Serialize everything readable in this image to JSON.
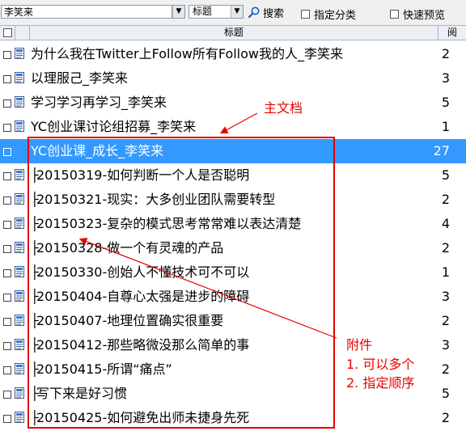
{
  "toolbar": {
    "search_value": "李笑来",
    "field_selected": "标题",
    "search_label": "搜索",
    "checkbox_category_label": "指定分类",
    "checkbox_preview_label": "快速预览"
  },
  "table": {
    "columns": {
      "title": "标题",
      "reads": "阅"
    },
    "rows": [
      {
        "title": "为什么我在Twitter上Follow所有Follow我的人_李笑来",
        "reads": "2",
        "child": false
      },
      {
        "title": "以理服己_李笑来",
        "reads": "3",
        "child": false
      },
      {
        "title": "学习学习再学习_李笑来",
        "reads": "5",
        "child": false
      },
      {
        "title": "YC创业课讨论组招募_李笑来",
        "reads": "1",
        "child": false
      },
      {
        "title": "YC创业课_成长_李笑来",
        "reads": "27",
        "child": false,
        "selected": true
      },
      {
        "title": "20150319-如何判断一个人是否聪明",
        "reads": "5",
        "child": true
      },
      {
        "title": "20150321-现实：大多创业团队需要转型",
        "reads": "2",
        "child": true
      },
      {
        "title": "20150323-复杂的模式思考常常难以表达清楚",
        "reads": "4",
        "child": true
      },
      {
        "title": "20150328-做一个有灵魂的产品",
        "reads": "2",
        "child": true
      },
      {
        "title": "20150330-创始人不懂技术可不可以",
        "reads": "1",
        "child": true
      },
      {
        "title": "20150404-自尊心太强是进步的障碍",
        "reads": "3",
        "child": true
      },
      {
        "title": "20150407-地理位置确实很重要",
        "reads": "2",
        "child": true
      },
      {
        "title": "20150412-那些略微没那么简单的事",
        "reads": "3",
        "child": true
      },
      {
        "title": "20150415-所谓“痛点”",
        "reads": "2",
        "child": true
      },
      {
        "title": "写下来是好习惯",
        "reads": "5",
        "child": true
      },
      {
        "title": "20150425-如何避免出师未捷身先死",
        "reads": "2",
        "child": true
      }
    ]
  },
  "annotations": {
    "main_doc": "主文档",
    "attachment": "附件",
    "point1": "1. 可以多个",
    "point2": "2. 指定顺序"
  },
  "colors": {
    "selection": "#3399ff",
    "annotation": "#e60000",
    "header_bg": "#ecf0f5"
  }
}
